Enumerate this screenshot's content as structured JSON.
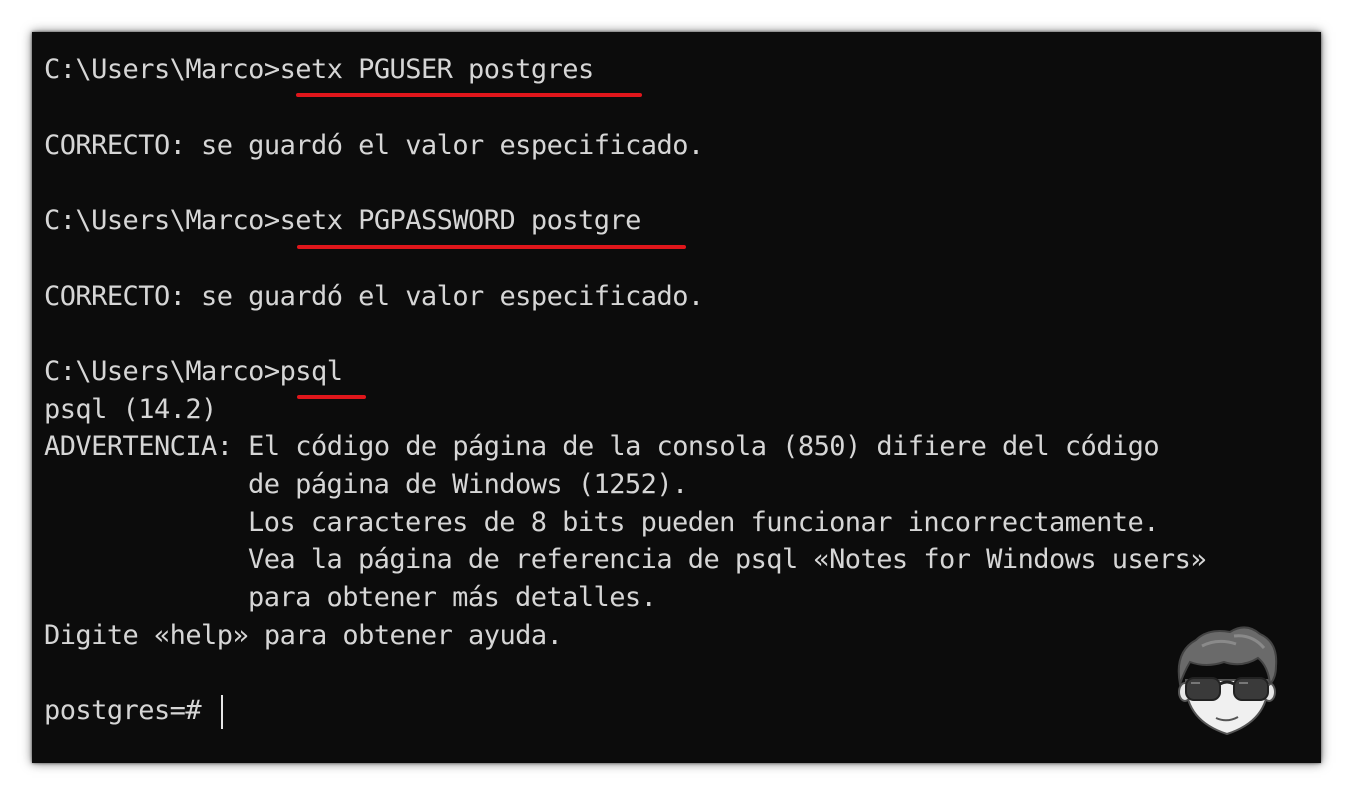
{
  "terminal": {
    "lines": {
      "cmd1": {
        "prompt": "C:\\Users\\Marco>",
        "command": "setx PGUSER postgres"
      },
      "out1": "CORRECTO: se guardó el valor especificado.",
      "cmd2": {
        "prompt": "C:\\Users\\Marco>",
        "command": "setx PGPASSWORD postgre"
      },
      "out2": "CORRECTO: se guardó el valor especificado.",
      "cmd3": {
        "prompt": "C:\\Users\\Marco>",
        "command": "psql"
      },
      "version": "psql (14.2)",
      "warn1": "ADVERTENCIA: El código de página de la consola (850) difiere del código",
      "warn2": "de página de Windows (1252).",
      "warn3": "Los caracteres de 8 bits pueden funcionar incorrectamente.",
      "warn4": "Vea la página de referencia de psql «Notes for Windows users»",
      "warn5": "para obtener más detalles.",
      "help": "Digite «help» para obtener ayuda.",
      "prompt_final": "postgres=# "
    },
    "colors": {
      "background": "#0c0c0c",
      "text": "#d6d6d6",
      "underline": "#e0161b"
    }
  },
  "avatar": {
    "icon": "cartoon-avatar-sunglasses-icon"
  }
}
